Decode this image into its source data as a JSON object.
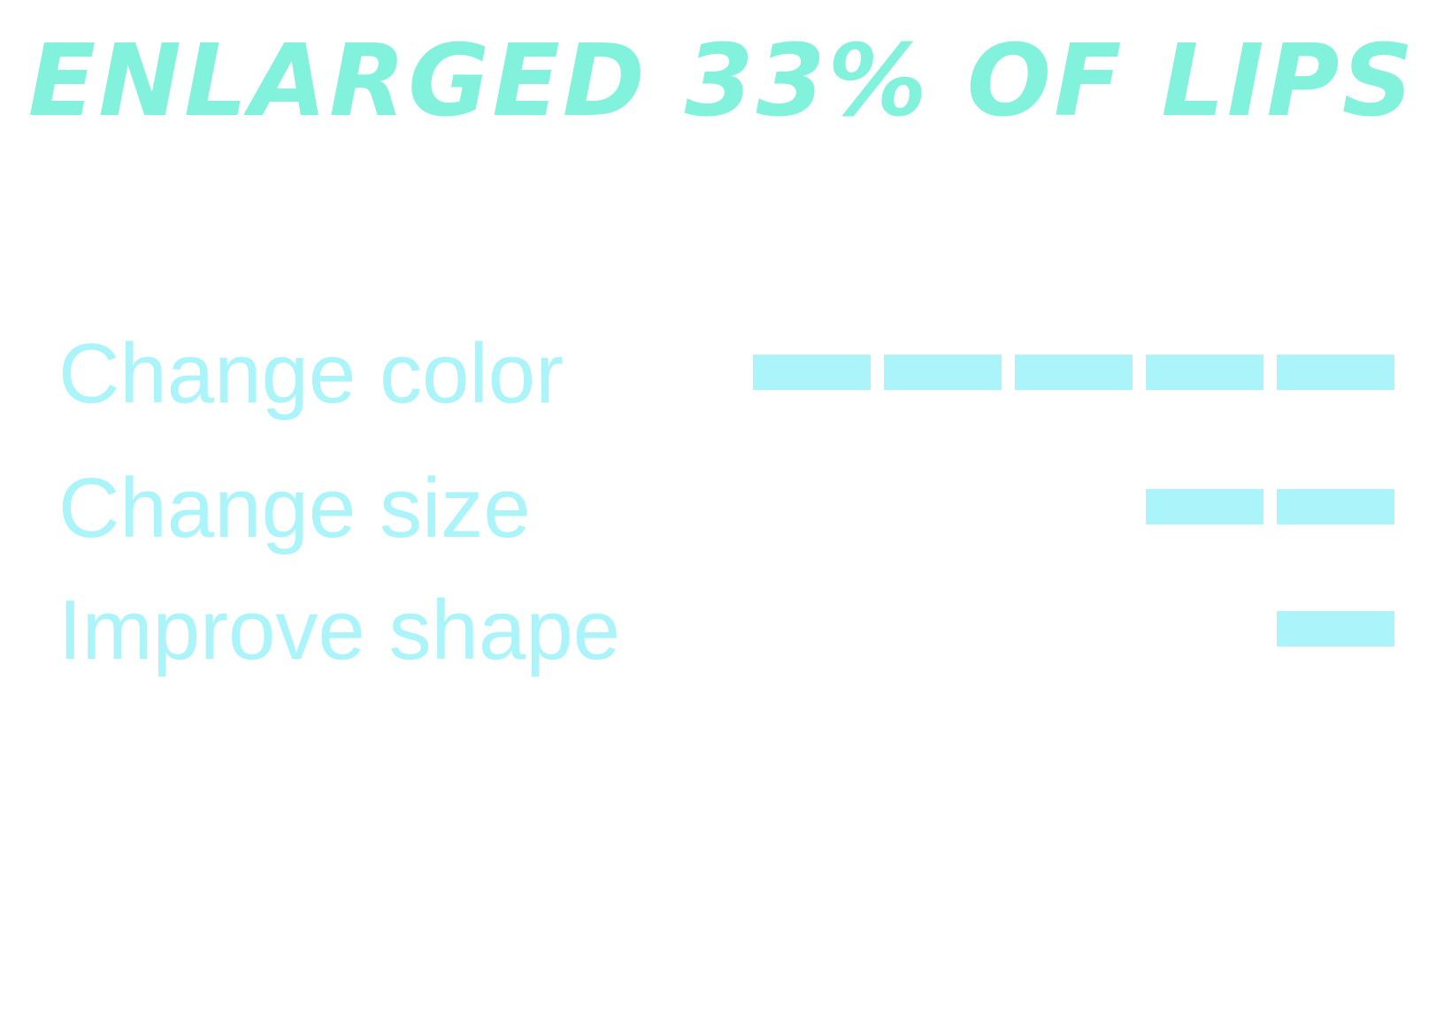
{
  "chart_data": {
    "type": "bar",
    "title": "ENLARGED 33% OF LIPS",
    "title_color": "#82f2dc",
    "label_color": "#aaf4fa",
    "bar_color": "#aaf4fa",
    "max_units": 5,
    "categories": [
      "Change color",
      "Change size",
      "Improve shape"
    ],
    "values": [
      5,
      2,
      1
    ]
  }
}
